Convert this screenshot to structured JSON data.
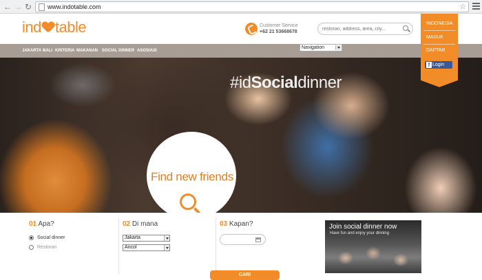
{
  "browser": {
    "url": "www.indotable.com"
  },
  "header": {
    "logo_left": "ind",
    "logo_right": "table",
    "customer_service_label": "Customer Service",
    "phone": "+62 21 53668678",
    "search_placeholder": "restoran, address, area, city..."
  },
  "side_panel": {
    "items": [
      "INDONESIA",
      "MASUK",
      "DAFTAR"
    ],
    "fb_login_label": "Login"
  },
  "nav": {
    "items": [
      "JAKARTA",
      "BALI",
      "KRITERIA",
      "MAKANAN",
      "SOCIAL DINNER",
      "ASOSIASI"
    ],
    "navigation_select": "Navigation"
  },
  "hero": {
    "hashtag_prefix": "#id",
    "hashtag_strong": "Social",
    "hashtag_suffix": "dinner",
    "bubble_text": "Find new friends"
  },
  "form": {
    "step1": {
      "num": "01",
      "title": "Apa?",
      "options": [
        "Social dinner",
        "Restoran"
      ],
      "selected": "Social dinner"
    },
    "step2": {
      "num": "02",
      "title": "Di mana",
      "city": "Jakarta",
      "area": "Ancol"
    },
    "step3": {
      "num": "03",
      "title": "Kapan?"
    },
    "promo_title": "Join social dinner now",
    "promo_subtitle": "Have fun and enjoy your dinning",
    "submit_label": "CARI"
  },
  "colors": {
    "brand_orange": "#f28c28",
    "nav_bar": "#a79d95",
    "facebook_blue": "#3b5998"
  }
}
